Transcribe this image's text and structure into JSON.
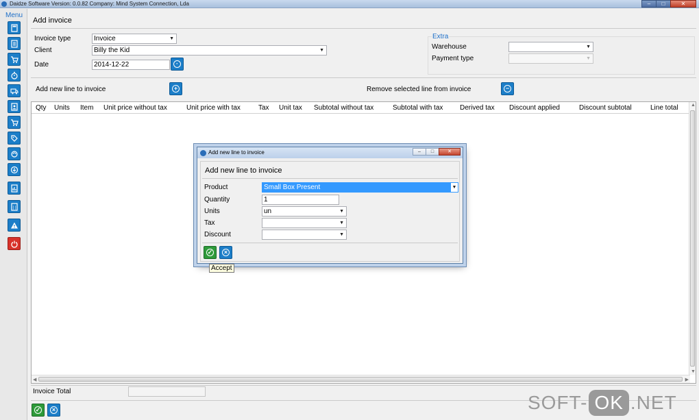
{
  "window": {
    "title": "Daidze Software Version: 0.0.82 Company: Mind System Connection, Lda",
    "minimize": "–",
    "maximize": "□",
    "close": "✕"
  },
  "sidebar": {
    "menu_label": "Menu",
    "items": [
      {
        "icon": "calculator-icon"
      },
      {
        "icon": "document-icon"
      },
      {
        "icon": "cart-icon"
      },
      {
        "icon": "stopwatch-icon"
      },
      {
        "icon": "delivery-truck-icon"
      },
      {
        "icon": "contact-card-icon"
      },
      {
        "icon": "shopping-cart-icon"
      },
      {
        "icon": "tag-icon"
      },
      {
        "icon": "refresh-icon"
      },
      {
        "icon": "download-icon"
      },
      {
        "icon": "chart-icon"
      },
      {
        "icon": "calculator-grid-icon"
      },
      {
        "icon": "warning-icon"
      },
      {
        "icon": "power-icon"
      }
    ]
  },
  "page": {
    "title": "Add invoice",
    "invoice_type_label": "Invoice type",
    "invoice_type_value": "Invoice",
    "client_label": "Client",
    "client_value": "Billy the Kid",
    "date_label": "Date",
    "date_value": "2014-12-22",
    "extra_title": "Extra",
    "warehouse_label": "Warehouse",
    "warehouse_value": "",
    "payment_type_label": "Payment type",
    "payment_type_value": "",
    "add_line_label": "Add new line to invoice",
    "remove_line_label": "Remove selected line from invoice",
    "invoice_total_label": "Invoice Total",
    "invoice_total_value": ""
  },
  "grid": {
    "columns": [
      "Qty",
      "Units",
      "Item",
      "Unit price without tax",
      "Unit price with tax",
      "Tax",
      "Unit tax",
      "Subtotal without tax",
      "Subtotal with tax",
      "Derived tax",
      "Discount applied",
      "Discount subtotal",
      "Line total"
    ],
    "rows": []
  },
  "dialog": {
    "window_title": "Add new line to invoice",
    "heading": "Add new line to invoice",
    "product_label": "Product",
    "product_value": "Small Box Present",
    "quantity_label": "Quantity",
    "quantity_value": "1",
    "units_label": "Units",
    "units_value": "un",
    "tax_label": "Tax",
    "tax_value": "",
    "discount_label": "Discount",
    "discount_value": "",
    "tooltip": "Accept"
  },
  "watermark": {
    "left": "SOFT-",
    "mid": "OK",
    "right": ".NET"
  },
  "colors": {
    "accent_blue": "#1c7ec8",
    "selection_blue": "#3399ff",
    "accept_green": "#2e9a3a",
    "exit_red": "#d8322a",
    "section_title_blue": "#1e6fc8"
  }
}
